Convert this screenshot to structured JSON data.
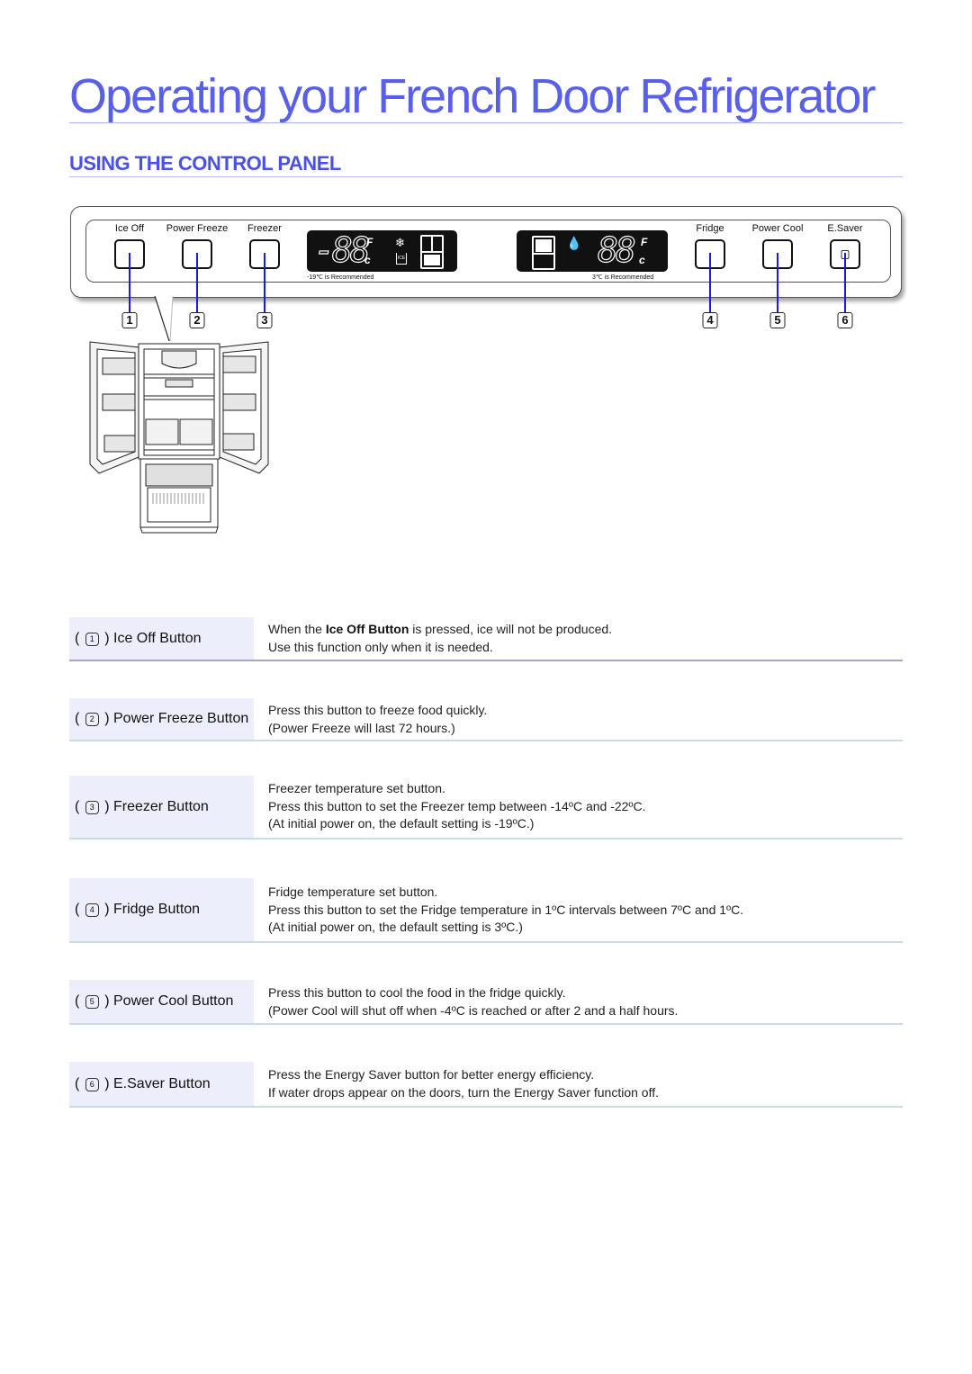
{
  "page": {
    "title": "Operating your French Door Refrigerator",
    "section_title": "USING THE CONTROL PANEL"
  },
  "panel": {
    "buttons": [
      {
        "num": "1",
        "label": "Ice Off"
      },
      {
        "num": "2",
        "label": "Power Freeze"
      },
      {
        "num": "3",
        "label": "Freezer"
      },
      {
        "num": "4",
        "label": "Fridge"
      },
      {
        "num": "5",
        "label": "Power Cool"
      },
      {
        "num": "6",
        "label": "E.Saver"
      }
    ],
    "freezer_display": {
      "digits": "-88",
      "unit_f": "F",
      "unit_c": "c",
      "icons": [
        "snowflake-icon",
        "ice-off-cup-icon",
        "freezer-door-icon"
      ],
      "recommend": "-19℃ is Recommended"
    },
    "fridge_display": {
      "digits": "88",
      "unit_f": "F",
      "unit_c": "c",
      "icons": [
        "fridge-door-icon",
        "water-drop-icon"
      ],
      "recommend": "3℃ is Recommended"
    }
  },
  "rows": [
    {
      "num": "1",
      "label": "Ice Off Button",
      "lines": [
        {
          "pre": "When the ",
          "bold": "Ice Off Button",
          "post": " is pressed, ice will not be produced."
        },
        {
          "pre": "Use this function only when it is needed."
        }
      ]
    },
    {
      "num": "2",
      "label": "Power Freeze Button",
      "lines": [
        {
          "pre": "Press this button to freeze food quickly."
        },
        {
          "pre": "(Power Freeze will last 72 hours.)"
        }
      ]
    },
    {
      "num": "3",
      "label": "Freezer Button",
      "lines": [
        {
          "pre": "Freezer temperature set button."
        },
        {
          "pre": "Press this button to set the Freezer temp between -14ºC and -22ºC."
        },
        {
          "pre": "(At initial power on, the default setting is -19ºC.)"
        }
      ]
    },
    {
      "num": "4",
      "label": "Fridge Button",
      "lines": [
        {
          "pre": "Fridge temperature set button."
        },
        {
          "pre": "Press this button to set the Fridge temperature in 1ºC intervals between 7ºC and 1ºC."
        },
        {
          "pre": "(At initial power on, the default setting is 3ºC.)"
        }
      ]
    },
    {
      "num": "5",
      "label": "Power Cool Button",
      "lines": [
        {
          "pre": "Press this button to cool the food in the fridge quickly."
        },
        {
          "pre": "(Power Cool will shut off when -4ºC is reached or after 2 and a half hours."
        }
      ]
    },
    {
      "num": "6",
      "label": "E.Saver Button",
      "lines": [
        {
          "pre": "Press the Energy Saver button for better energy efficiency."
        },
        {
          "pre": "If water drops appear on the doors, turn the Energy Saver function off."
        }
      ]
    }
  ],
  "colors": {
    "title": "#5960e8",
    "section": "#4a52e6",
    "leader": "#1a1ae8",
    "label_bg": "#eceefb",
    "rule_purple": "#a7a6c2",
    "rule_teal": "#c6dde3"
  }
}
